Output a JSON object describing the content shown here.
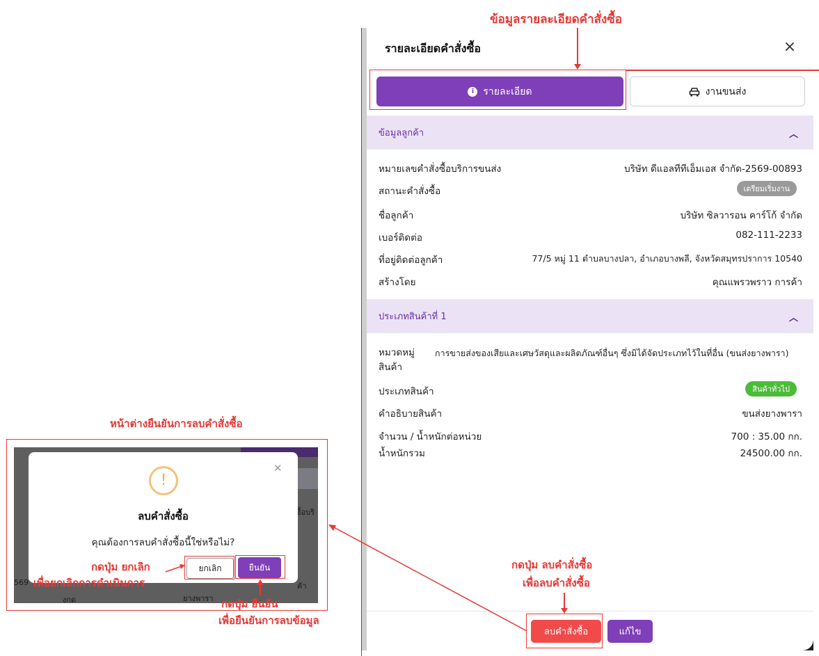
{
  "drawer": {
    "title": "รายละเอียดคำสั่งซื้อ",
    "close_icon": "×",
    "tabs": [
      {
        "label": "รายละเอียด",
        "icon": "info-icon"
      },
      {
        "label": "งานขนส่ง",
        "icon": "car-icon"
      }
    ],
    "customer_section": {
      "title": "ข้อมูลลูกค้า",
      "rows": [
        {
          "label": "หมายเลขคำสั่งซื้อบริการขนส่ง",
          "value": "บริษัท ดีแอลทีทีเอ็มเอส จำกัด-2569-00893"
        },
        {
          "label": "สถานะคำสั่งซื้อ",
          "badge": "เตรียมเริ่มงาน"
        },
        {
          "label": "ชื่อลูกค้า",
          "value": "บริษัท ซิลวารอน คาร์โก้ จำกัด"
        },
        {
          "label": "เบอร์ติดต่อ",
          "value": "082-111-2233"
        },
        {
          "label": "ที่อยู่ติดต่อลูกค้า",
          "value": "77/5 หมู่ 11 ตำบลบางปลา, อำเภอบางพลี, จังหวัดสมุทรปราการ 10540"
        },
        {
          "label": "สร้างโดย",
          "value": "คุณแพรวพราว การค้า"
        }
      ]
    },
    "product_section": {
      "title": "ประเภทสินค้าที่ 1",
      "category_label": "หมวดหมู่สินค้า",
      "category_value": "การขายส่งของเสียและเศษวัสดุและผลิตภัณฑ์อื่นๆ ซึ่งมิได้จัดประเภทไว้ในที่อื่น (ขนส่งยางพารา)",
      "type_label": "ประเภทสินค้า",
      "type_badge": "สินค้าทั่วไป",
      "desc_label": "คำอธิบายสินค้า",
      "desc_value": "ขนส่งยางพารา",
      "qty_label": "จำนวน / น้ำหนักต่อหน่วย",
      "qty_value": "700 : 35.00 กก.",
      "total_label": "น้ำหนักรวม",
      "total_value": "24500.00 กก."
    },
    "footer": {
      "delete_label": "ลบคำสั่งซื้อ",
      "edit_label": "แก้ไข"
    }
  },
  "dialog": {
    "title": "ลบคำสั่งซื้อ",
    "message": "คุณต้องการลบคำสั่งซื้อนี้ใช่หรือไม่?",
    "cancel_label": "ยกเลิก",
    "confirm_label": "ยืนยัน",
    "bg_text_right": "ซื้อบริ",
    "bg_text_left": "569",
    "bg_text_bottom1": "งกด",
    "bg_text_bottom2": "ยางพารา",
    "bg_text_bottom3": "ค้า"
  },
  "annotations": {
    "top_title": "ข้อมูลรายละเอียดคำสั่งซื้อ",
    "dialog_title": "หน้าต่างยืนยันการลบคำสั่งซื้อ",
    "delete_note_1": "กดปุ่ม ลบคำสั่งซื้อ",
    "delete_note_2": "เพื่อลบคำสั่งซื้อ",
    "cancel_note_1": "กดปุ่ม ยกเลิก",
    "cancel_note_2": "เพื่อยกเลิกการดำเนินการ",
    "confirm_note_1": "กดปุ่ม ยืนยัน",
    "confirm_note_2": "เพื่อยืนยันการลบข้อมูล"
  },
  "colors": {
    "accent": "#7e3fb8",
    "danger": "#f14a4a",
    "annotation": "#e53935"
  }
}
